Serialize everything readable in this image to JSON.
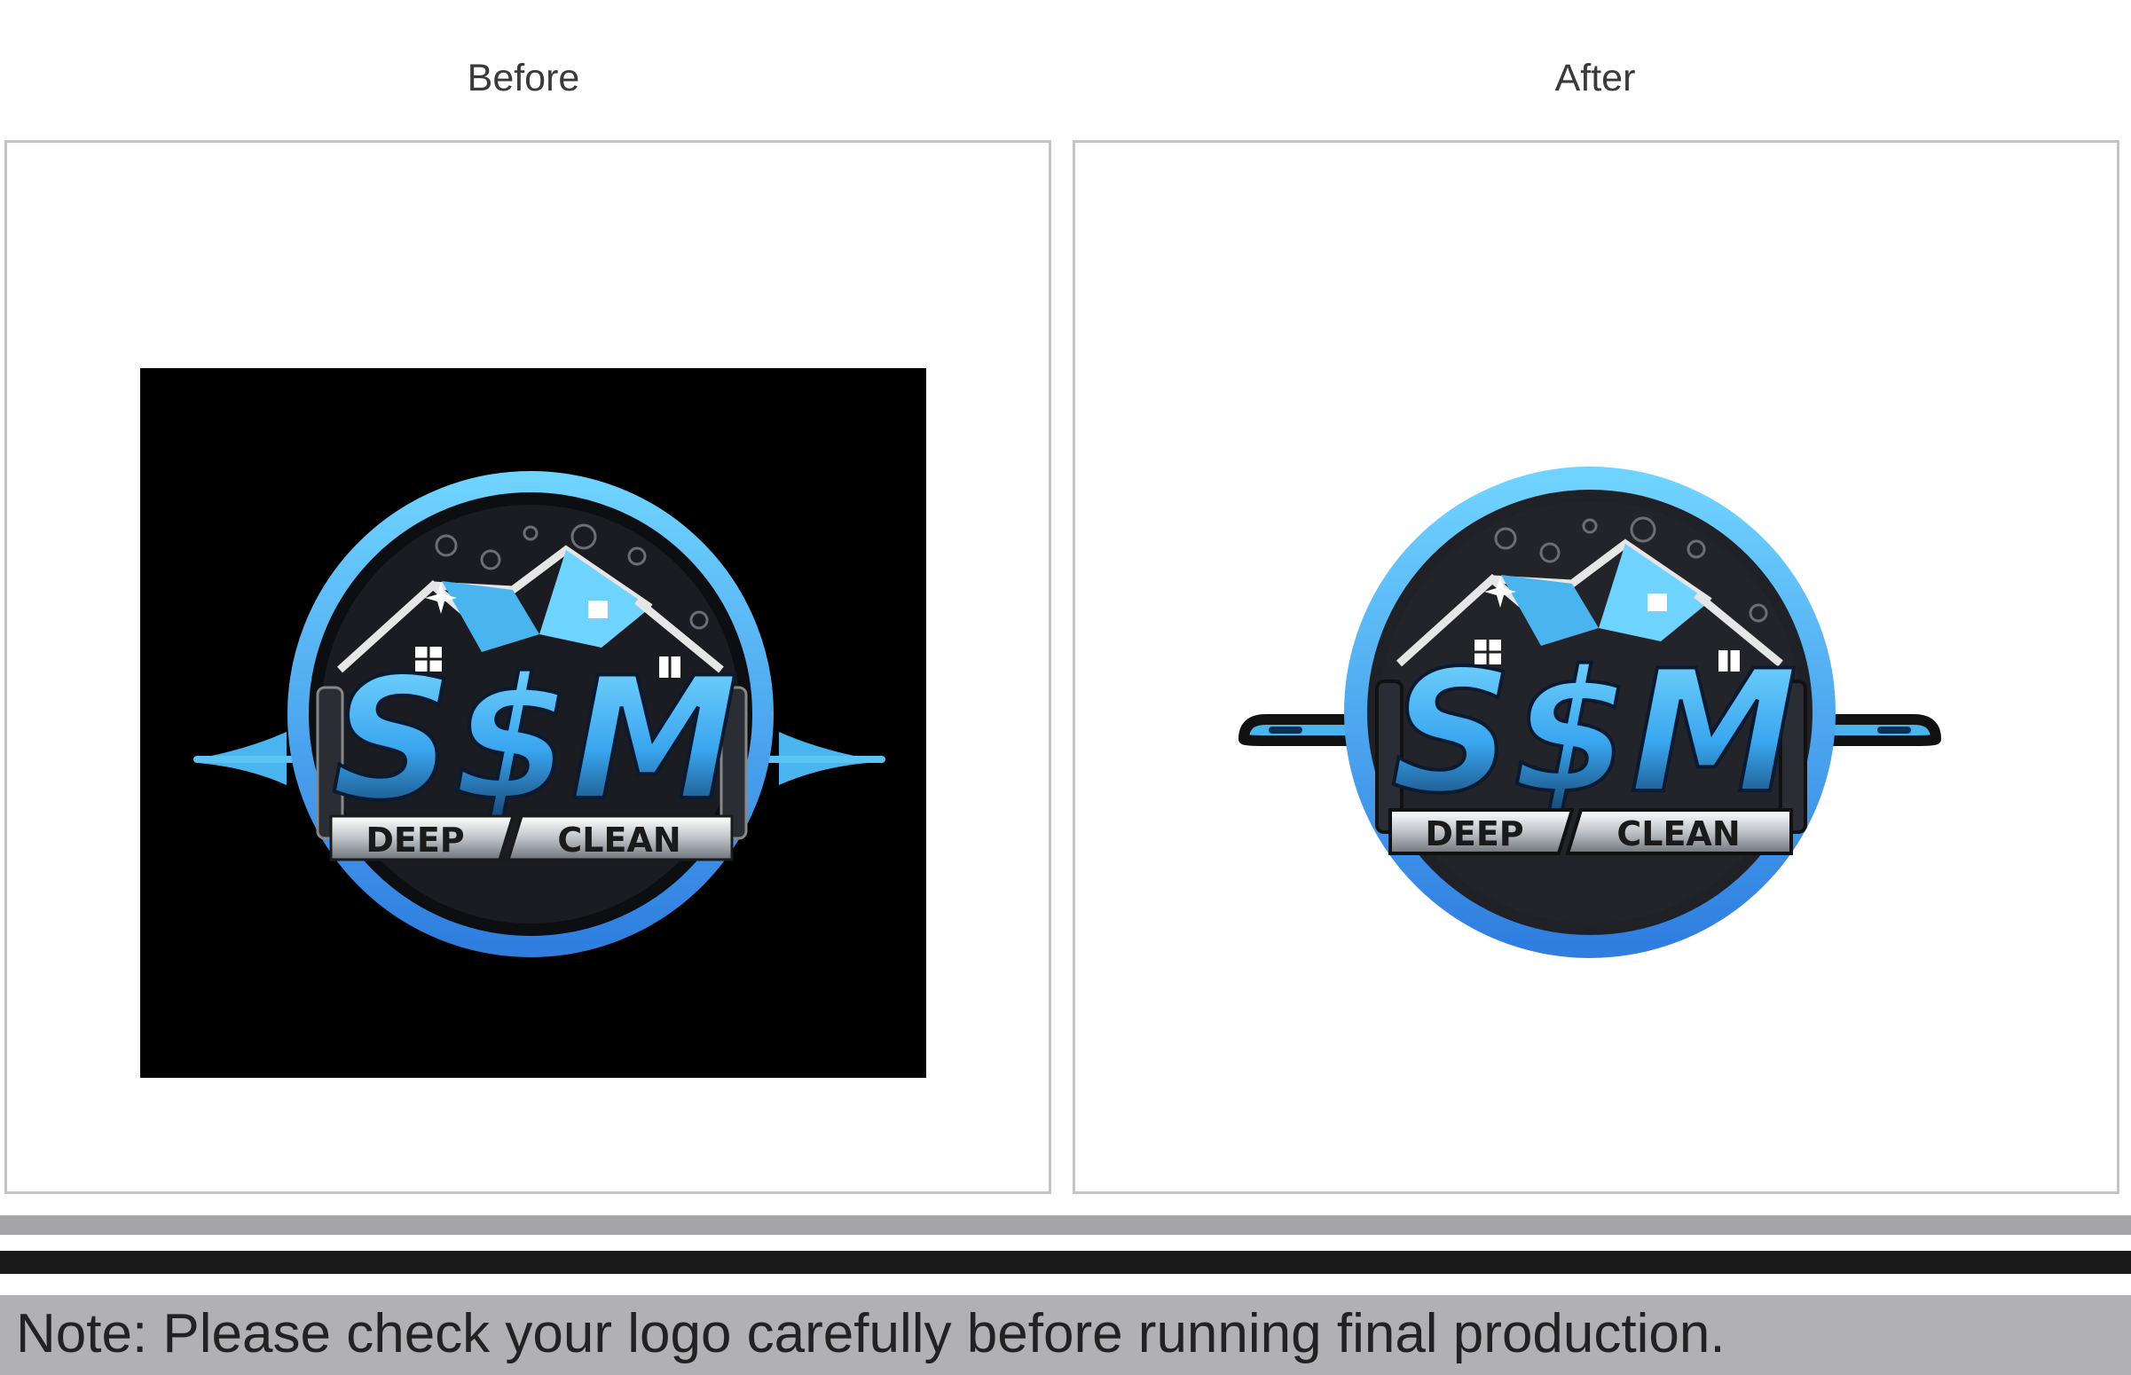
{
  "headings": {
    "before": "Before",
    "after": "After"
  },
  "logo": {
    "brand": "S$M",
    "tagline_left": "DEEP",
    "tagline_right": "CLEAN"
  },
  "note": "Note: Please check your logo carefully before running final production.",
  "colors": {
    "accent_blue": "#3fa9f5",
    "light_blue": "#6fd3ff",
    "dark_circle": "#1f2126",
    "panel_border": "#c4c4c4",
    "note_bar": "#b1b1b3"
  }
}
